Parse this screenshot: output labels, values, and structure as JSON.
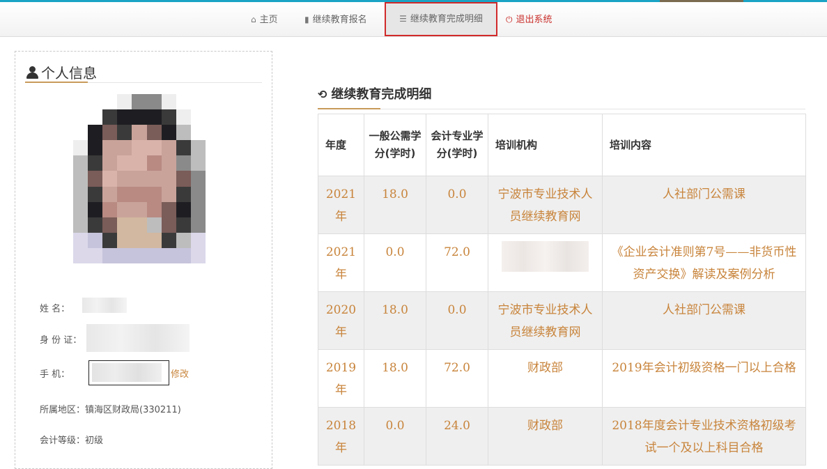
{
  "nav": {
    "home": "主页",
    "register": "继续教育报名",
    "detail": "继续教育完成明细",
    "logout": "退出系统"
  },
  "profile": {
    "title": "个人信息",
    "name_label": "姓      名：",
    "id_label": "身 份 证：",
    "phone_label": "手      机：",
    "edit": "修改",
    "region_label": "所属地区：",
    "region": "镇海区财政局(330211)",
    "level_label": "会计等级：",
    "level": "初级"
  },
  "records": {
    "title": "继续教育完成明细",
    "headers": [
      "年度",
      "一般公需学分(学时)",
      "会计专业学分(学时)",
      "培训机构",
      "培训内容"
    ],
    "rows": [
      {
        "year": "2021年",
        "general": "18.0",
        "professional": "0.0",
        "org": "宁波市专业技术人员继续教育网",
        "content": "人社部门公需课"
      },
      {
        "year": "2021年",
        "general": "0.0",
        "professional": "72.0",
        "org": "",
        "content": "《企业会计准则第7号——非货币性资产交换》解读及案例分析"
      },
      {
        "year": "2020年",
        "general": "18.0",
        "professional": "0.0",
        "org": "宁波市专业技术人员继续教育网",
        "content": "人社部门公需课"
      },
      {
        "year": "2019年",
        "general": "18.0",
        "professional": "72.0",
        "org": "财政部",
        "content": "2019年会计初级资格一门以上合格"
      },
      {
        "year": "2018年",
        "general": "0.0",
        "professional": "24.0",
        "org": "财政部",
        "content": "2018年度会计专业技术资格初级考试一个及以上科目合格"
      }
    ]
  },
  "icons": {
    "home": "home-icon",
    "book": "book-icon",
    "list": "list-icon",
    "power": "power-icon",
    "user": "user-icon",
    "history": "history-icon"
  },
  "colors": {
    "accent": "#c8843b",
    "active_border": "#d12a2a",
    "logout": "#c9302c"
  }
}
